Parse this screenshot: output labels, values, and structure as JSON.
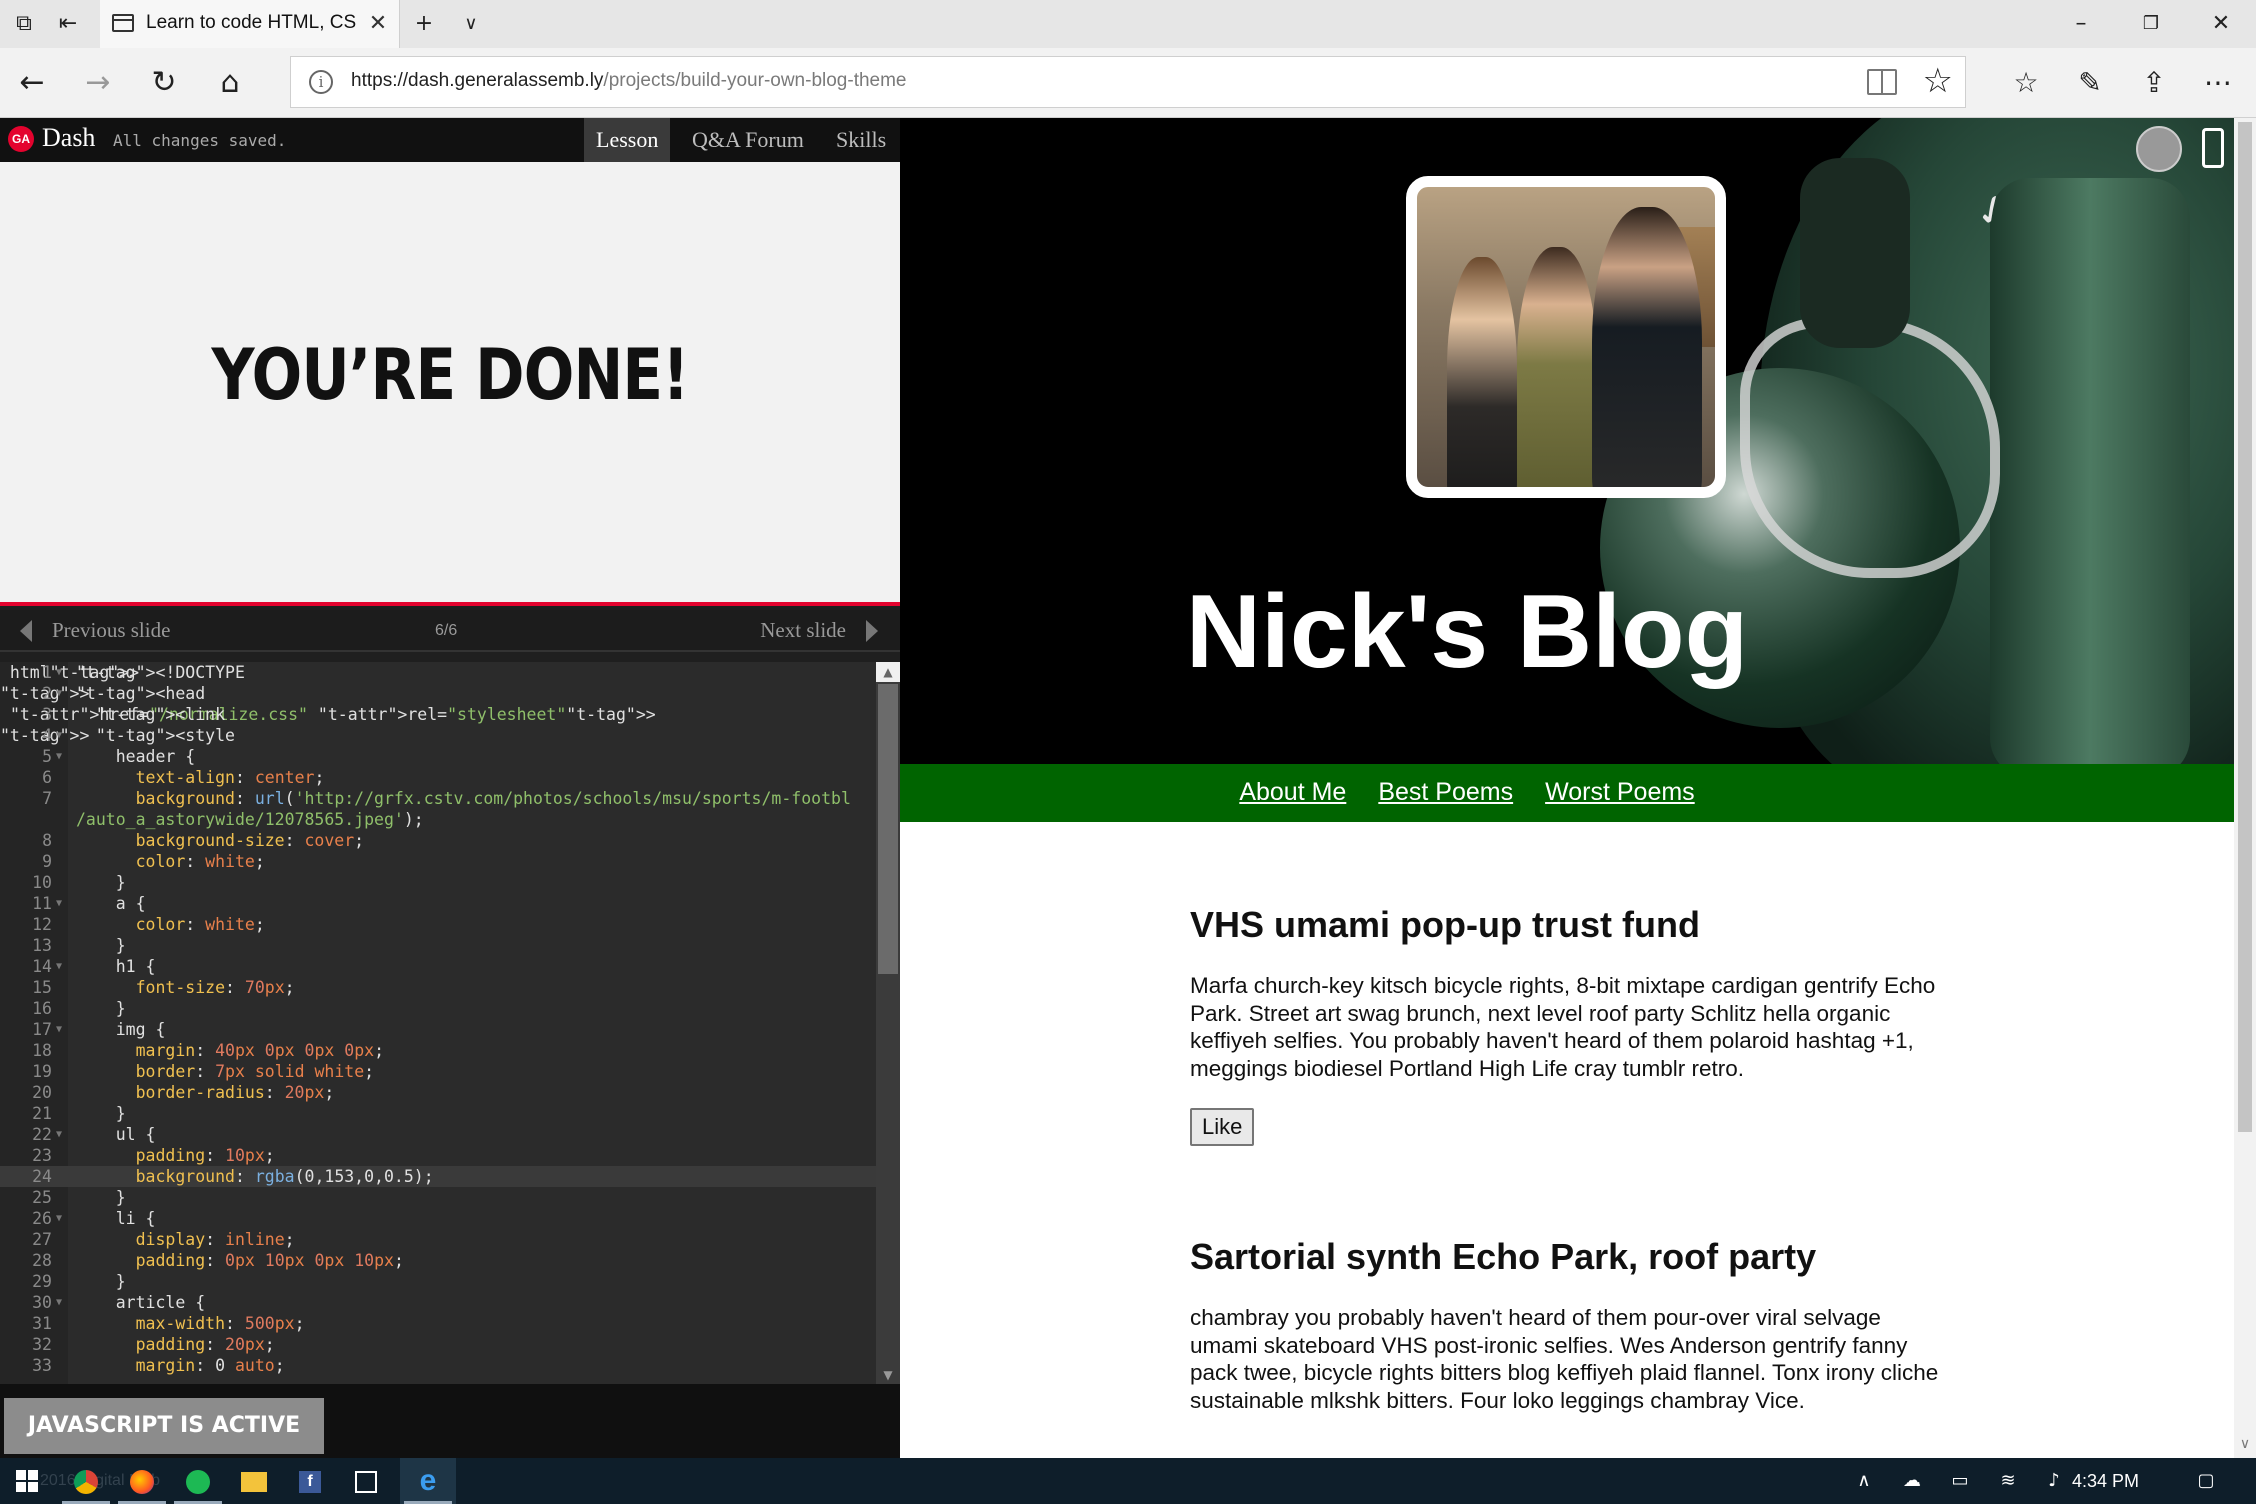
{
  "browser": {
    "tab_title": "Learn to code HTML, CSS",
    "url_host": "https://dash.generalassemb.ly",
    "url_path": "/projects/build-your-own-blog-theme"
  },
  "dash": {
    "brand": "Dash",
    "status": "All changes saved.",
    "tabs": [
      "Lesson",
      "Q&A Forum",
      "Skills"
    ],
    "active_tab": "Lesson",
    "slide_heading": "YOU’RE DONE!",
    "prev_label": "Previous slide",
    "next_label": "Next slide",
    "slide_counter": "6/6",
    "js_button": "JAVASCRIPT IS ACTIVE"
  },
  "editor": {
    "active_line": 24,
    "lines": [
      {
        "n": "1",
        "fold": true,
        "t": "<!DOCTYPE html>"
      },
      {
        "n": "2",
        "fold": true,
        "t": "<head>"
      },
      {
        "n": "3",
        "fold": false,
        "t": "  <link href=\"/normalize.css\" rel=\"stylesheet\">"
      },
      {
        "n": "4",
        "fold": true,
        "t": "  <style>"
      },
      {
        "n": "5",
        "fold": true,
        "t": "    header {"
      },
      {
        "n": "6",
        "fold": false,
        "t": "      text-align: center;"
      },
      {
        "n": "7",
        "fold": false,
        "t": "      background: url('http://grfx.cstv.com/photos/schools/msu/sports/m-footbl",
        "t2": "/auto_a_astorywide/12078565.jpeg');"
      },
      {
        "n": "8",
        "fold": false,
        "t": "      background-size: cover;"
      },
      {
        "n": "9",
        "fold": false,
        "t": "      color: white;"
      },
      {
        "n": "10",
        "fold": false,
        "t": "    }"
      },
      {
        "n": "11",
        "fold": true,
        "t": "    a {"
      },
      {
        "n": "12",
        "fold": false,
        "t": "      color: white;"
      },
      {
        "n": "13",
        "fold": false,
        "t": "    }"
      },
      {
        "n": "14",
        "fold": true,
        "t": "    h1 {"
      },
      {
        "n": "15",
        "fold": false,
        "t": "      font-size: 70px;"
      },
      {
        "n": "16",
        "fold": false,
        "t": "    }"
      },
      {
        "n": "17",
        "fold": true,
        "t": "    img {"
      },
      {
        "n": "18",
        "fold": false,
        "t": "      margin: 40px 0px 0px 0px;"
      },
      {
        "n": "19",
        "fold": false,
        "t": "      border: 7px solid white;"
      },
      {
        "n": "20",
        "fold": false,
        "t": "      border-radius: 20px;"
      },
      {
        "n": "21",
        "fold": false,
        "t": "    }"
      },
      {
        "n": "22",
        "fold": true,
        "t": "    ul {"
      },
      {
        "n": "23",
        "fold": false,
        "t": "      padding: 10px;"
      },
      {
        "n": "24",
        "fold": false,
        "t": "      background: rgba(0,153,0,0.5);"
      },
      {
        "n": "25",
        "fold": false,
        "t": "    }"
      },
      {
        "n": "26",
        "fold": true,
        "t": "    li {"
      },
      {
        "n": "27",
        "fold": false,
        "t": "      display: inline;"
      },
      {
        "n": "28",
        "fold": false,
        "t": "      padding: 0px 10px 0px 10px;"
      },
      {
        "n": "29",
        "fold": false,
        "t": "    }"
      },
      {
        "n": "30",
        "fold": true,
        "t": "    article {"
      },
      {
        "n": "31",
        "fold": false,
        "t": "      max-width: 500px;"
      },
      {
        "n": "32",
        "fold": false,
        "t": "      padding: 20px;"
      },
      {
        "n": "33",
        "fold": false,
        "t": "      margin: 0 auto;"
      }
    ]
  },
  "blog": {
    "title": "Nick's Blog",
    "nav": [
      "About Me",
      "Best Poems",
      "Worst Poems"
    ],
    "nav_color": "#006400",
    "articles": [
      {
        "title": "VHS umami pop-up trust fund",
        "body": "Marfa church-key kitsch bicycle rights, 8-bit mixtape cardigan gentrify Echo Park. Street art swag brunch, next level roof party Schlitz hella organic keffiyeh selfies. You probably haven't heard of them polaroid hashtag +1, meggings biodiesel Portland High Life cray tumblr retro.",
        "button": "Like"
      },
      {
        "title": "Sartorial synth Echo Park, roof party",
        "body": "chambray you probably haven't heard of them pour-over viral selvage umami skateboard VHS post-ironic selfies. Wes Anderson gentrify fanny pack twee, bicycle rights bitters blog keffiyeh plaid flannel. Tonx irony cliche sustainable mlkshk bitters. Four loko leggings chambray Vice."
      }
    ]
  },
  "taskbar": {
    "time": "4:34 PM",
    "ghost_text": "2016 Digital Mob"
  },
  "colors": {
    "ga_red": "#e4032e",
    "editor_bg": "#2b2b2b",
    "taskbar": "#0e1e2a"
  }
}
